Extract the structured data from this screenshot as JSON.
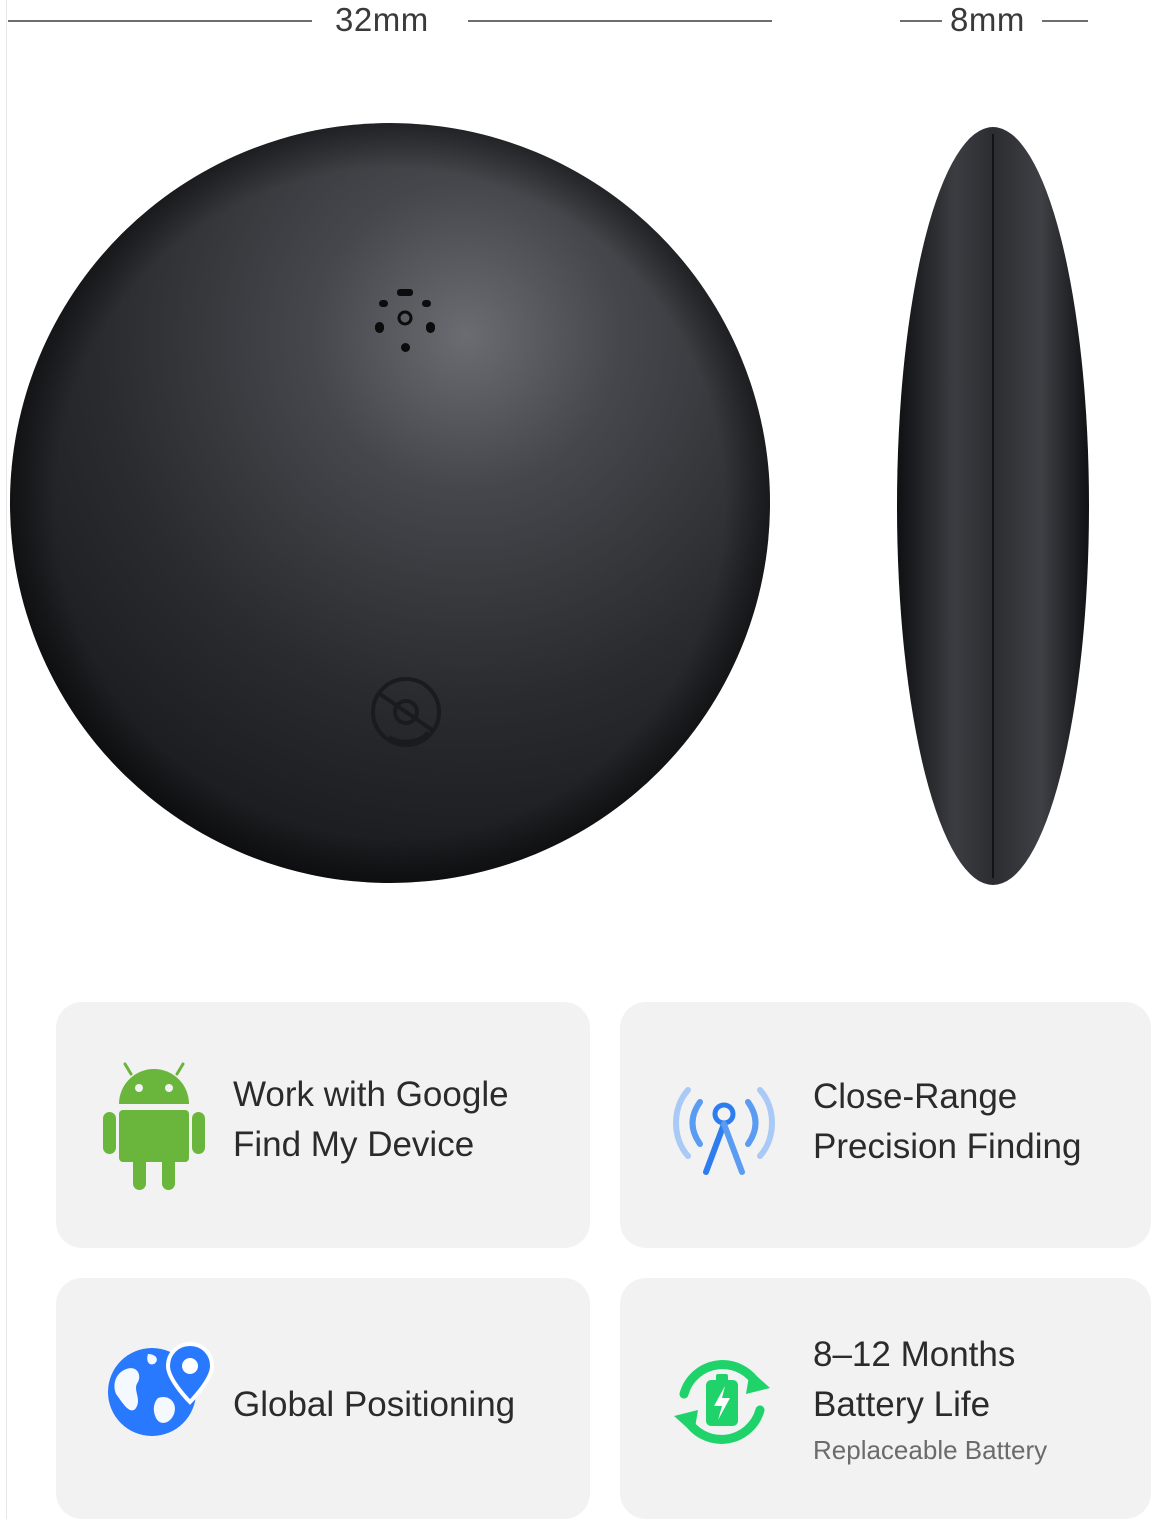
{
  "dimensions": {
    "width_label": "32mm",
    "thickness_label": "8mm"
  },
  "product": {
    "color": "#2a2b2e"
  },
  "features": [
    {
      "icon": "android-icon",
      "lines": [
        "Work with Google",
        "Find My Device"
      ],
      "sub": ""
    },
    {
      "icon": "signal-antenna-icon",
      "lines": [
        "Close-Range",
        "Precision Finding"
      ],
      "sub": ""
    },
    {
      "icon": "globe-location-icon",
      "lines": [
        "Global Positioning"
      ],
      "sub": ""
    },
    {
      "icon": "battery-recycle-icon",
      "lines": [
        "8–12 Months",
        "Battery Life"
      ],
      "sub": "Replaceable Battery"
    }
  ],
  "colors": {
    "android_green": "#6ab63c",
    "signal_blue": "#2d7df0",
    "globe_blue": "#2979ff",
    "battery_green": "#1fd36a",
    "card_bg": "#f2f2f2"
  }
}
